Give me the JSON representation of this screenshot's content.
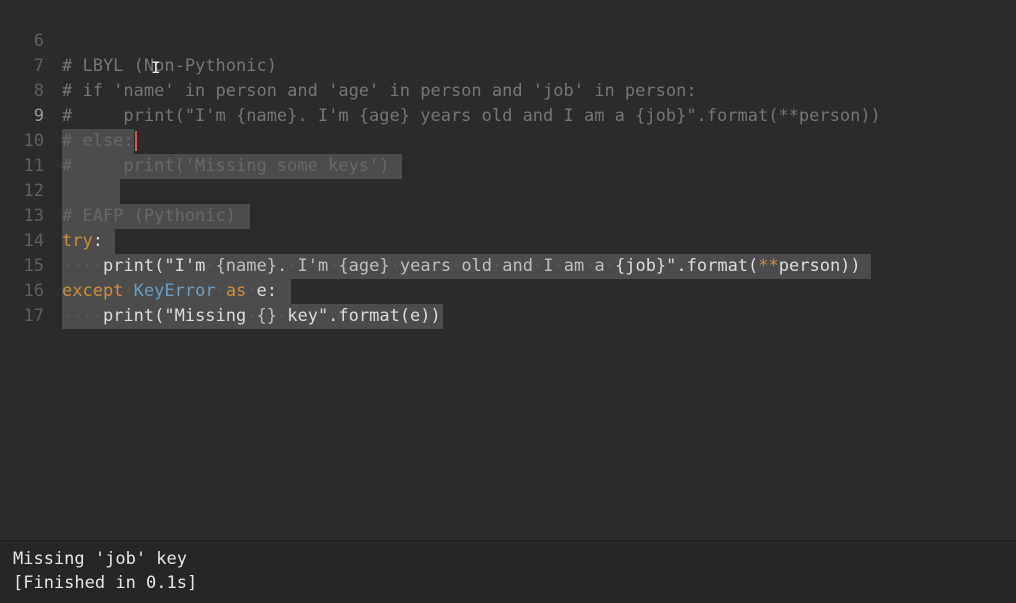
{
  "editor": {
    "line_numbers": [
      "6",
      "7",
      "8",
      "9",
      "10",
      "11",
      "12",
      "13",
      "14",
      "15",
      "16",
      "17"
    ],
    "lines": {
      "l6": "# LBYL (Non-Pythonic)",
      "l7": "# if 'name' in person and 'age' in person and 'job' in person:",
      "l8": "#     print(\"I'm {name}. I'm {age} years old and I am a {job}\".format(**person))",
      "l9": "# else:",
      "l10": "#     print('Missing some keys')",
      "l12": "# EAFP (Pythonic)",
      "l13_kw": "try",
      "l13_rest": ":",
      "l14_ws": "····",
      "l14_a": "print(\"I'm",
      "l14_b": "{name}.",
      "l14_c": "I'm",
      "l14_d": "{age}",
      "l14_e": "years",
      "l14_f": "old",
      "l14_g": "and",
      "l14_h": "I",
      "l14_i": "am",
      "l14_j": "a",
      "l14_k": "{job}\".format(",
      "l14_op": "**",
      "l14_l": "person))",
      "l15_kw": "except",
      "l15_cls": "KeyError",
      "l15_as": "as",
      "l15_rest": "e:",
      "l16_ws": "····",
      "l16_a": "print(\"Missing",
      "l16_b": "{}",
      "l16_c": "key\".format(e))"
    }
  },
  "output": {
    "line1": "Missing 'job' key",
    "line2": "[Finished in 0.1s]"
  },
  "colors": {
    "background": "#2b2b2b",
    "selection": "#4c4c4c",
    "keyword": "#cc8e3a",
    "class_name": "#6c9cc0",
    "comment": "#767676",
    "cursor": "#e05050"
  }
}
